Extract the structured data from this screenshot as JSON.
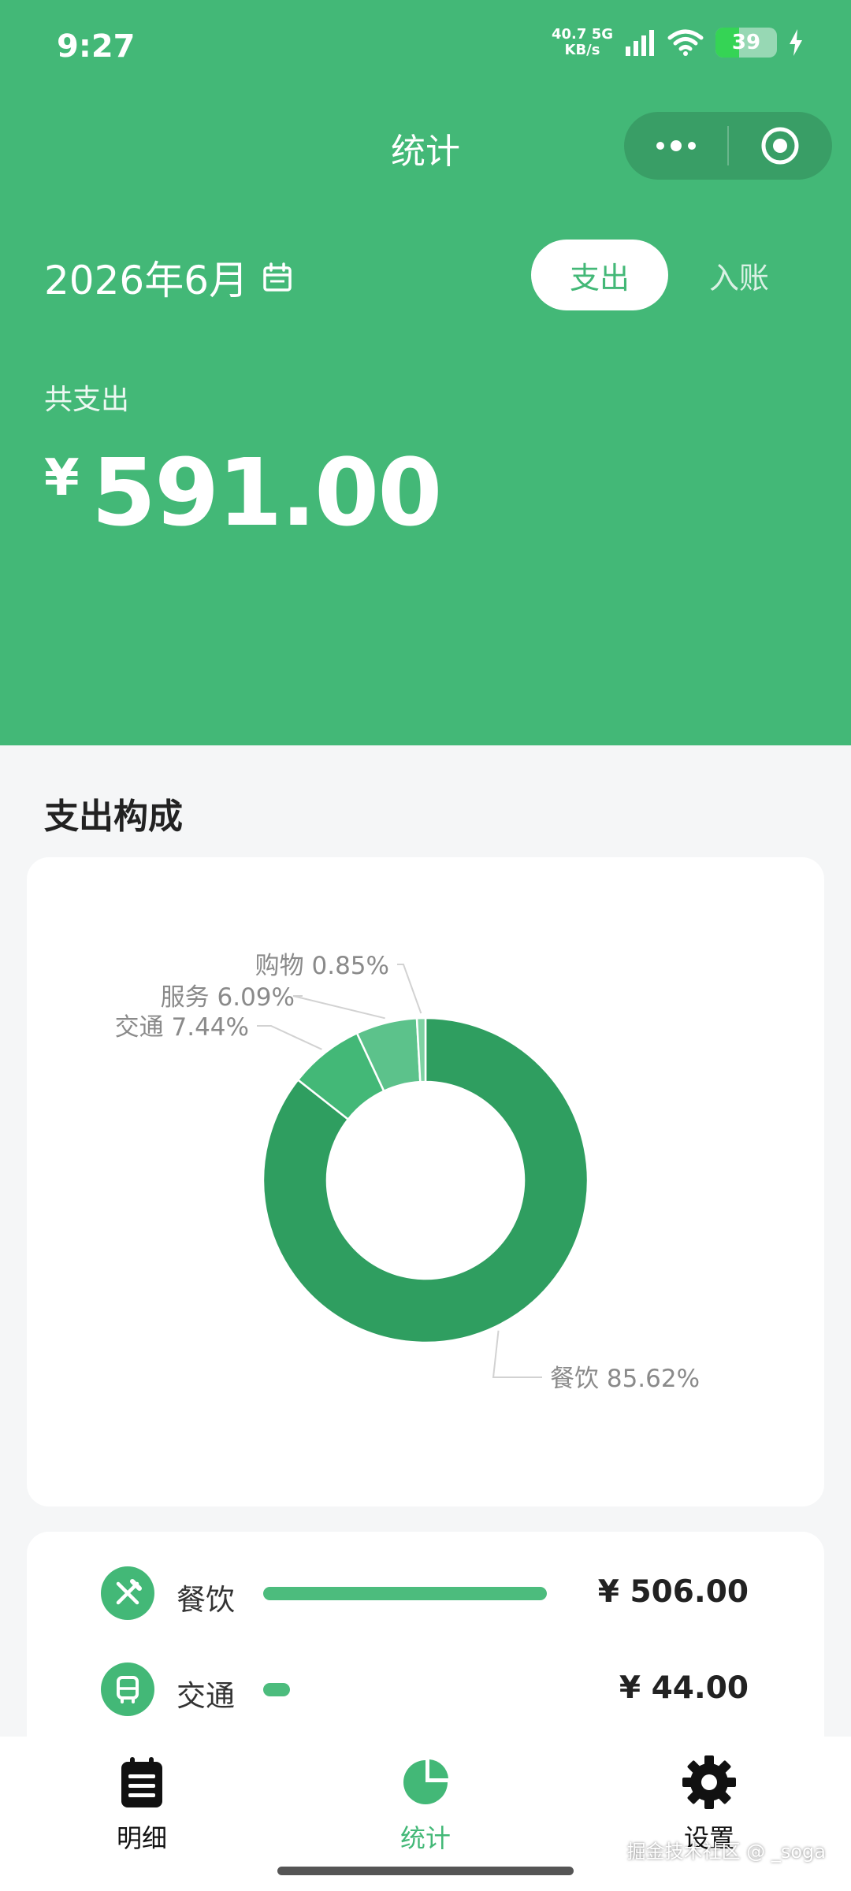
{
  "status_bar": {
    "time": "9:27",
    "net_speed_value": "40.7",
    "net_speed_unit": "KB/s",
    "network_type": "5G",
    "battery": "39",
    "battery_level": 0.39
  },
  "nav": {
    "title": "统计"
  },
  "filter": {
    "month": "2026年6月",
    "tabs": [
      {
        "label": "支出",
        "active": true
      },
      {
        "label": "入账",
        "active": false
      }
    ]
  },
  "summary": {
    "label": "共支出",
    "currency": "¥",
    "amount": "591.00"
  },
  "section": {
    "title": "支出构成"
  },
  "chart_data": {
    "type": "pie",
    "categories": [
      "餐饮",
      "交通",
      "服务",
      "购物"
    ],
    "values": [
      85.62,
      7.44,
      6.09,
      0.85
    ],
    "labels": [
      "餐饮 85.62%",
      "交通 7.44%",
      "服务 6.09%",
      "购物 0.85%"
    ],
    "colors": [
      "#2f9e60",
      "#43b877",
      "#5cc28b",
      "#7ed3a3"
    ],
    "legend": "none"
  },
  "categories": [
    {
      "name": "餐饮",
      "icon": "utensils-icon",
      "amount": "¥ 506.00",
      "share": 1.0
    },
    {
      "name": "交通",
      "icon": "bus-icon",
      "amount": "¥ 44.00",
      "share": 0.087
    }
  ],
  "tabbar": {
    "items": [
      {
        "label": "明细",
        "icon": "list-icon",
        "active": false
      },
      {
        "label": "统计",
        "icon": "pie-chart-icon",
        "active": true
      },
      {
        "label": "设置",
        "icon": "gear-icon",
        "active": false
      }
    ]
  },
  "watermark": "掘金技术社区 @ _soga",
  "colors": {
    "brand": "#43b877",
    "background": "#f5f6f7"
  }
}
